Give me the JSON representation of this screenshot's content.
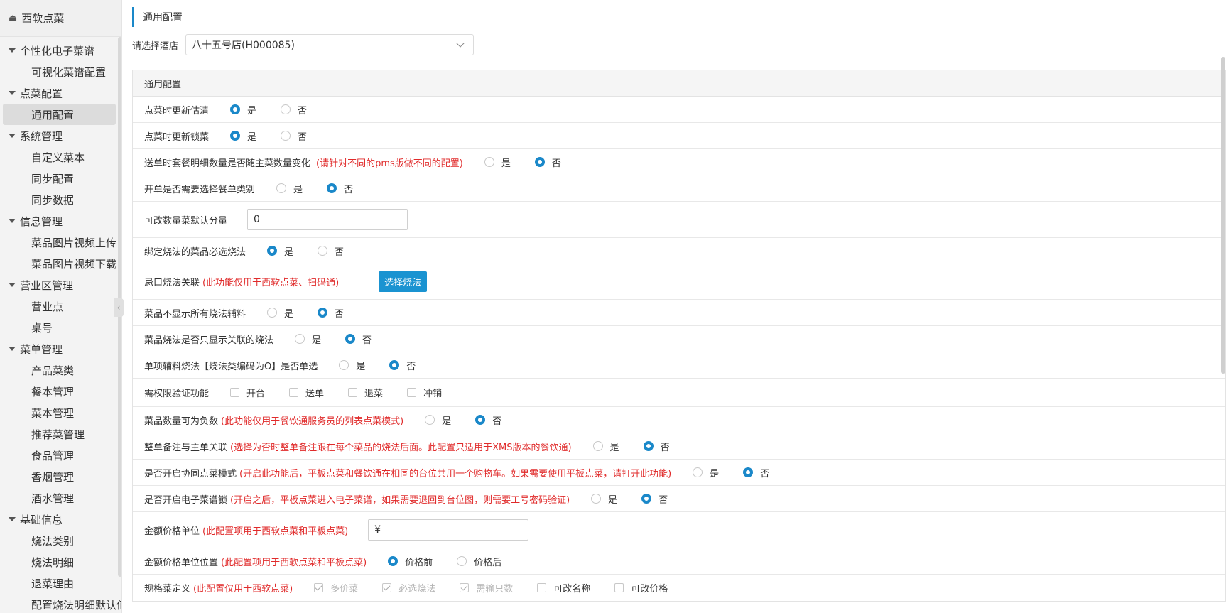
{
  "app": {
    "title": "西软点菜"
  },
  "sidebar": {
    "groups": [
      {
        "label": "个性化电子菜谱",
        "items": [
          "可视化菜谱配置"
        ]
      },
      {
        "label": "点菜配置",
        "items": [
          "通用配置"
        ]
      },
      {
        "label": "系统管理",
        "items": [
          "自定义菜本",
          "同步配置",
          "同步数据"
        ]
      },
      {
        "label": "信息管理",
        "items": [
          "菜品图片视频上传",
          "菜品图片视频下载"
        ]
      },
      {
        "label": "营业区管理",
        "items": [
          "营业点",
          "桌号"
        ]
      },
      {
        "label": "菜单管理",
        "items": [
          "产品菜类",
          "餐本管理",
          "菜本管理",
          "推荐菜管理",
          "食品管理",
          "香烟管理",
          "酒水管理"
        ]
      },
      {
        "label": "基础信息",
        "items": [
          "烧法类别",
          "烧法明细",
          "退菜理由",
          "配置烧法明细默认值"
        ]
      }
    ]
  },
  "page": {
    "title": "通用配置",
    "hotel_label": "请选择酒店",
    "hotel_value": "八十五号店(H000085)",
    "panel_title": "通用配置"
  },
  "rows": {
    "r1": {
      "label": "点菜时更新估清",
      "yes": "是",
      "no": "否"
    },
    "r2": {
      "label": "点菜时更新锁菜",
      "yes": "是",
      "no": "否"
    },
    "r3": {
      "label": "送单时套餐明细数量是否随主菜数量变化",
      "note": "(请针对不同的pms版做不同的配置)",
      "yes": "是",
      "no": "否"
    },
    "r4": {
      "label": "开单是否需要选择餐单类别",
      "yes": "是",
      "no": "否"
    },
    "r5": {
      "label": "可改数量菜默认分量",
      "value": "0"
    },
    "r6": {
      "label": "绑定烧法的菜品必选烧法",
      "yes": "是",
      "no": "否"
    },
    "r7": {
      "label": "忌口烧法关联",
      "note": "(此功能仅用于西软点菜、扫码通)",
      "button": "选择烧法"
    },
    "r8": {
      "label": "菜品不显示所有烧法辅料",
      "yes": "是",
      "no": "否"
    },
    "r9": {
      "label": "菜品烧法是否只显示关联的烧法",
      "yes": "是",
      "no": "否"
    },
    "r10": {
      "label": "单项辅料烧法【烧法类编码为O】是否单选",
      "yes": "是",
      "no": "否"
    },
    "r11": {
      "label": "需权限验证功能",
      "opts": [
        "开台",
        "送单",
        "退菜",
        "冲销"
      ]
    },
    "r12": {
      "label": "菜品数量可为负数",
      "note": "(此功能仅用于餐饮通服务员的列表点菜模式)",
      "yes": "是",
      "no": "否"
    },
    "r13": {
      "label": "整单备注与主单关联",
      "note": "(选择为否时整单备注跟在每个菜品的烧法后面。此配置只适用于XMS版本的餐饮通)",
      "yes": "是",
      "no": "否"
    },
    "r14": {
      "label": "是否开启协同点菜模式",
      "note": "(开启此功能后，平板点菜和餐饮通在相同的台位共用一个购物车。如果需要使用平板点菜，请打开此功能)",
      "yes": "是",
      "no": "否"
    },
    "r15": {
      "label": "是否开启电子菜谱锁",
      "note": "(开启之后，平板点菜进入电子菜谱，如果需要退回到台位图，则需要工号密码验证)",
      "yes": "是",
      "no": "否"
    },
    "r16": {
      "label": "金额价格单位",
      "note": "(此配置项用于西软点菜和平板点菜)",
      "value": "¥"
    },
    "r17": {
      "label": "金额价格单位位置",
      "note": "(此配置项用于西软点菜和平板点菜)",
      "opt1": "价格前",
      "opt2": "价格后"
    },
    "r18": {
      "label": "规格菜定义",
      "note": "(此配置仅用于西软点菜)",
      "opts": [
        "多价菜",
        "必选烧法",
        "需输只数",
        "可改名称",
        "可改价格"
      ]
    }
  },
  "colors": {
    "accent": "#1a88c9",
    "note": "#e02a2a",
    "button": "#1a93d1"
  }
}
